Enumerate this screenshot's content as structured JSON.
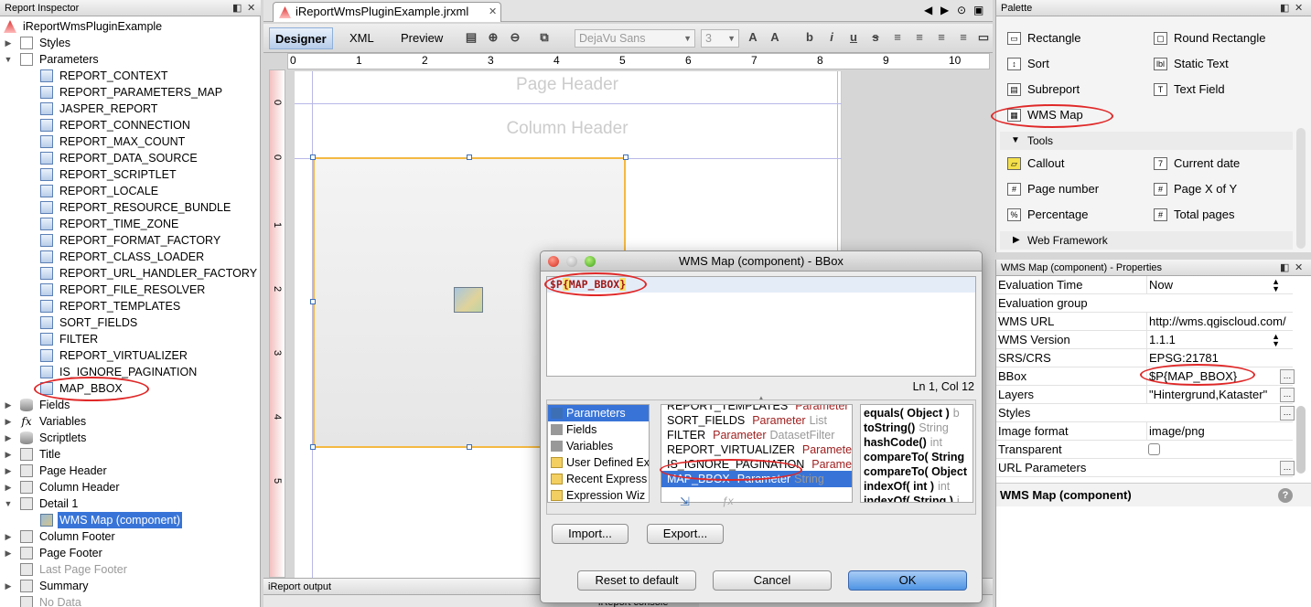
{
  "inspector": {
    "title": "Report Inspector",
    "root": "iReportWmsPluginExample",
    "styles": "Styles",
    "parameters": "Parameters",
    "params": [
      "REPORT_CONTEXT",
      "REPORT_PARAMETERS_MAP",
      "JASPER_REPORT",
      "REPORT_CONNECTION",
      "REPORT_MAX_COUNT",
      "REPORT_DATA_SOURCE",
      "REPORT_SCRIPTLET",
      "REPORT_LOCALE",
      "REPORT_RESOURCE_BUNDLE",
      "REPORT_TIME_ZONE",
      "REPORT_FORMAT_FACTORY",
      "REPORT_CLASS_LOADER",
      "REPORT_URL_HANDLER_FACTORY",
      "REPORT_FILE_RESOLVER",
      "REPORT_TEMPLATES",
      "SORT_FIELDS",
      "FILTER",
      "REPORT_VIRTUALIZER",
      "IS_IGNORE_PAGINATION",
      "MAP_BBOX"
    ],
    "fields": "Fields",
    "variables": "Variables",
    "scriptlets": "Scriptlets",
    "title_band": "Title",
    "page_header": "Page Header",
    "column_header": "Column Header",
    "detail": "Detail 1",
    "wms_map": "WMS Map (component)",
    "column_footer": "Column Footer",
    "page_footer": "Page Footer",
    "last_page_footer": "Last Page Footer",
    "summary": "Summary",
    "no_data": "No Data"
  },
  "editor": {
    "tab": "iReportWmsPluginExample.jrxml",
    "designer": "Designer",
    "xml": "XML",
    "preview": "Preview",
    "font": "DejaVu Sans",
    "size": "3",
    "ruler": [
      "0",
      "1",
      "2",
      "3",
      "4",
      "5",
      "6",
      "7",
      "8",
      "9",
      "10"
    ],
    "vruler": [
      "0",
      "0",
      "1",
      "2",
      "3",
      "4",
      "5"
    ],
    "page_header": "Page Header",
    "column_header": "Column Header",
    "output_title": "iReport output",
    "output_tab": "iReport console"
  },
  "palette": {
    "title": "Palette",
    "items": [
      {
        "l": "Rectangle",
        "ico": "rectangle-icon"
      },
      {
        "l": "Round Rectangle",
        "ico": "round-rectangle-icon"
      },
      {
        "l": "Sort",
        "ico": "sort-icon"
      },
      {
        "l": "Static Text",
        "ico": "static-text-icon"
      },
      {
        "l": "Subreport",
        "ico": "subreport-icon"
      },
      {
        "l": "Text Field",
        "ico": "text-field-icon"
      },
      {
        "l": "WMS Map",
        "ico": "wms-map-icon"
      }
    ],
    "tools": "Tools",
    "tool_items": [
      {
        "l": "Callout"
      },
      {
        "l": "Current date"
      },
      {
        "l": "Page number"
      },
      {
        "l": "Page X of Y"
      },
      {
        "l": "Percentage"
      },
      {
        "l": "Total pages"
      }
    ],
    "web": "Web Framework"
  },
  "properties": {
    "title": "WMS Map (component) - Properties",
    "rows": [
      {
        "k": "Evaluation Time",
        "v": "Now"
      },
      {
        "k": "Evaluation group",
        "v": ""
      },
      {
        "k": "WMS URL",
        "v": "http://wms.qgiscloud.com/"
      },
      {
        "k": "WMS Version",
        "v": "1.1.1"
      },
      {
        "k": "SRS/CRS",
        "v": "EPSG:21781"
      },
      {
        "k": "BBox",
        "v": "$P{MAP_BBOX}"
      },
      {
        "k": "Layers",
        "v": "\"Hintergrund,Kataster\""
      },
      {
        "k": "Styles",
        "v": ""
      },
      {
        "k": "Image format",
        "v": "image/png"
      },
      {
        "k": "Transparent",
        "v": ""
      },
      {
        "k": "URL Parameters",
        "v": ""
      }
    ],
    "footer": "WMS Map (component)"
  },
  "dialog": {
    "title": "WMS Map (component) - BBox",
    "expr_prefix": "$P",
    "expr_open": "{",
    "expr_name": "MAP_BBOX",
    "expr_close": "}",
    "position": "Ln 1, Col 12",
    "categories": [
      "Parameters",
      "Fields",
      "Variables",
      "User Defined Ex",
      "Recent Express",
      "Expression Wiz"
    ],
    "objects": [
      {
        "n": "REPORT_TEMPLATES",
        "t": "Parameter"
      },
      {
        "n": "SORT_FIELDS",
        "t": "Parameter",
        "c": "List"
      },
      {
        "n": "FILTER",
        "t": "Parameter",
        "c": "DatasetFilter"
      },
      {
        "n": "REPORT_VIRTUALIZER",
        "t": "Parameter"
      },
      {
        "n": "IS_IGNORE_PAGINATION",
        "t": "Parameter"
      },
      {
        "n": "MAP_BBOX",
        "t": "Parameter",
        "c": "String"
      }
    ],
    "methods": [
      {
        "m": "equals( Object )",
        "r": "b"
      },
      {
        "m": "toString()",
        "r": "String"
      },
      {
        "m": "hashCode()",
        "r": "int"
      },
      {
        "m": "compareTo( String",
        "r": ""
      },
      {
        "m": "compareTo( Object",
        "r": ""
      },
      {
        "m": "indexOf( int )",
        "r": "int"
      },
      {
        "m": "indexOf( String )",
        "r": "i"
      }
    ],
    "import": "Import...",
    "export": "Export...",
    "reset": "Reset to default",
    "cancel": "Cancel",
    "ok": "OK"
  }
}
